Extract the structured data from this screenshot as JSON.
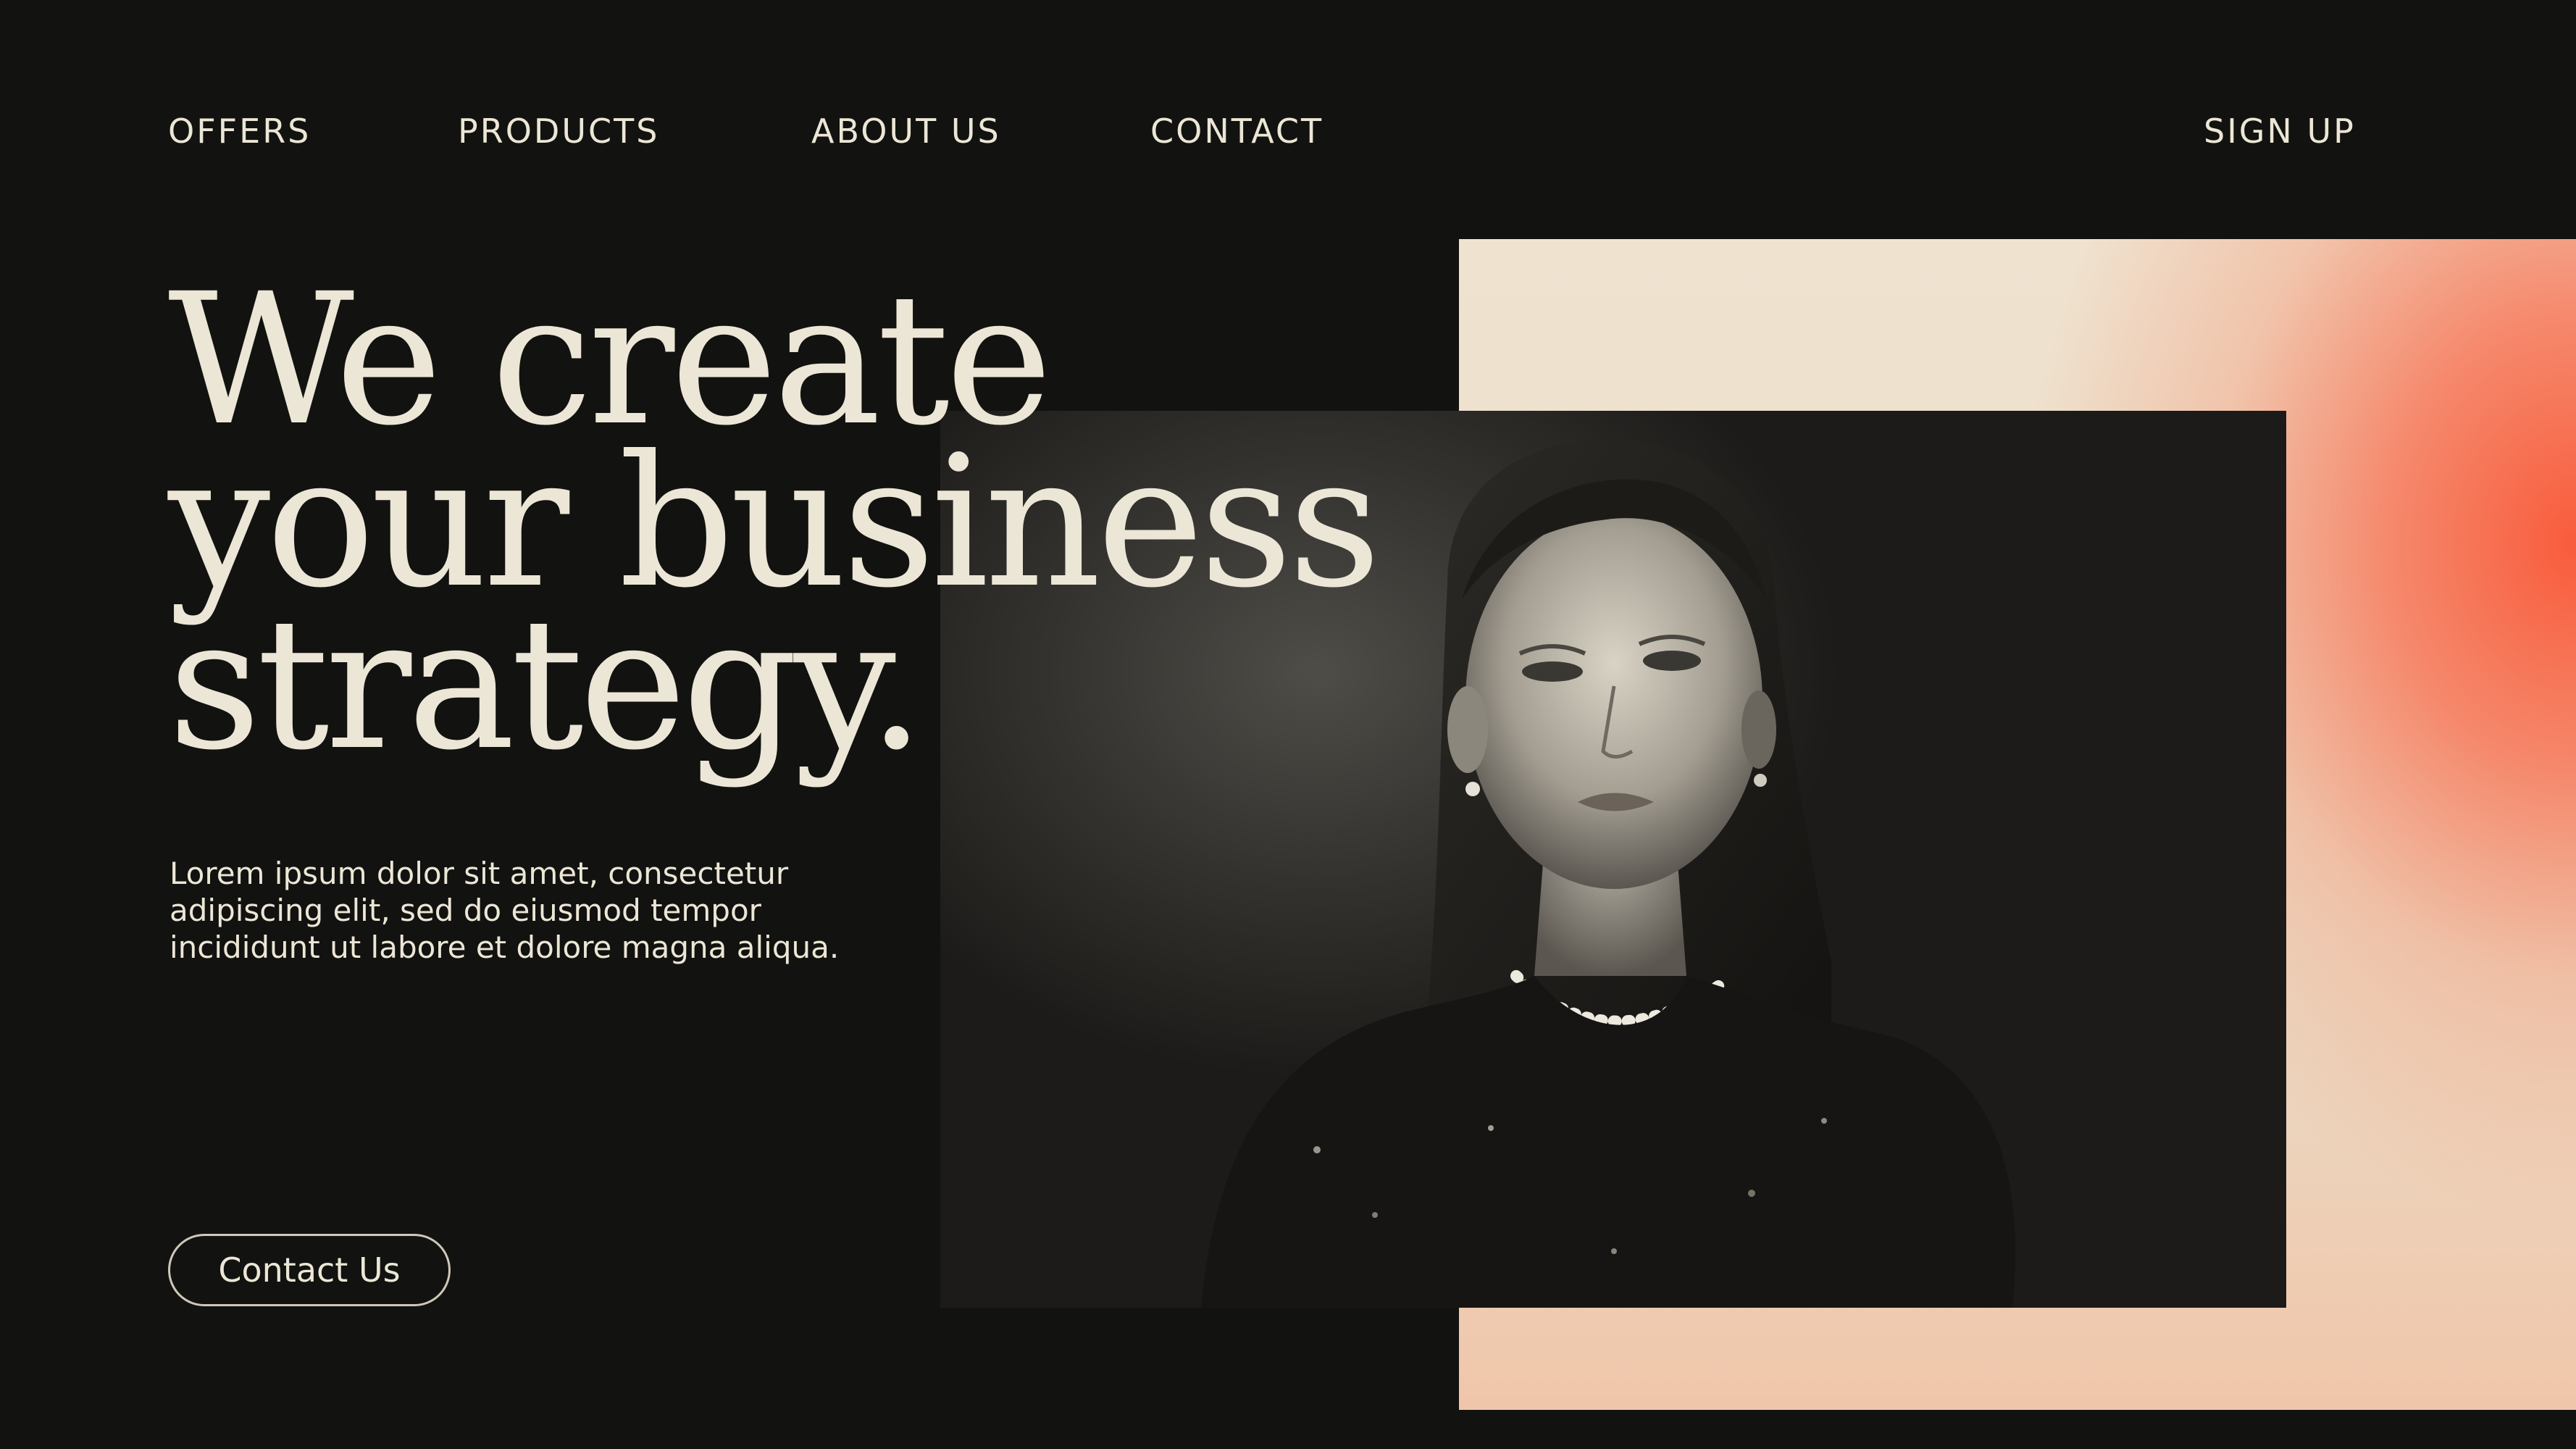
{
  "nav": {
    "offers": "OFFERS",
    "products": "PRODUCTS",
    "about": "ABOUT US",
    "contact": "CONTACT",
    "signup": "SIGN UP"
  },
  "hero": {
    "headline_lines": [
      "We create",
      "your business",
      "strategy."
    ],
    "body": "Lorem ipsum dolor sit amet, consectetur adipiscing elit, sed do eiusmod tempor incididunt ut labore et dolore magna aliqua.",
    "cta_label": "Contact Us",
    "photo_subject": "portrait-of-woman-with-pearl-necklace"
  },
  "colors": {
    "background": "#121210",
    "text": "#ece6d6",
    "panel_light": "#efe3d0",
    "panel_accent": "#f85c3c"
  }
}
